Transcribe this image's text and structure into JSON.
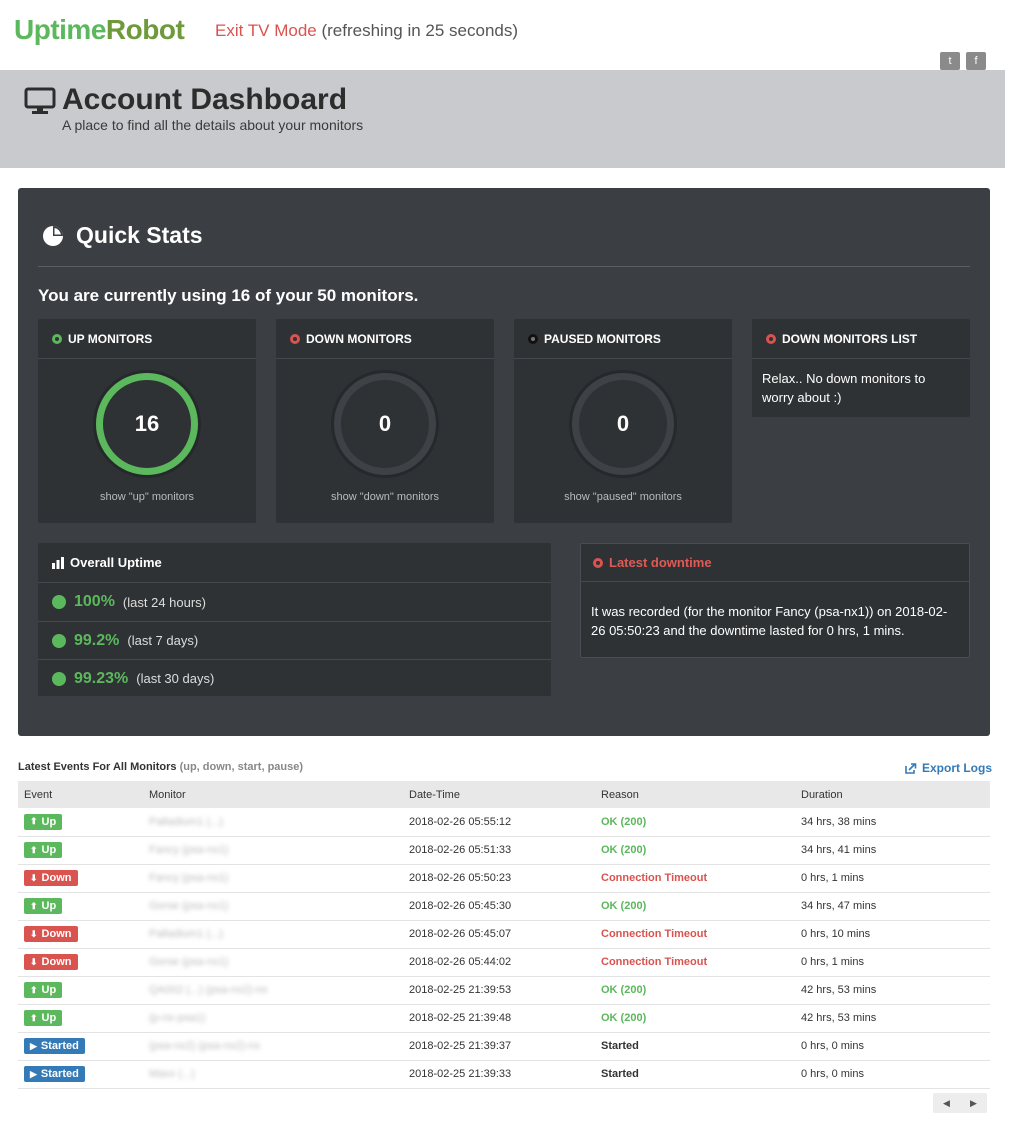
{
  "brand": {
    "uptime": "Uptime",
    "robot": "Robot"
  },
  "tv": {
    "exit_label": "Exit TV Mode",
    "refresh_text": "(refreshing in 25 seconds)"
  },
  "social": {
    "twitter": "t",
    "facebook": "f"
  },
  "header": {
    "title": "Account Dashboard",
    "subtitle": "A place to find all the details about your monitors"
  },
  "quick_stats": {
    "title": "Quick Stats",
    "usage": "You are currently using 16 of your 50 monitors.",
    "up": {
      "label": "UP MONITORS",
      "count": "16",
      "link": "show \"up\" monitors"
    },
    "down": {
      "label": "DOWN MONITORS",
      "count": "0",
      "link": "show \"down\" monitors"
    },
    "paused": {
      "label": "PAUSED MONITORS",
      "count": "0",
      "link": "show \"paused\" monitors"
    },
    "down_list": {
      "label": "DOWN MONITORS LIST",
      "text": "Relax.. No down monitors to worry about :)"
    },
    "overall": {
      "label": "Overall Uptime",
      "rows": [
        {
          "value": "100%",
          "period": "(last 24 hours)"
        },
        {
          "value": "99.2%",
          "period": "(last 7 days)"
        },
        {
          "value": "99.23%",
          "period": "(last 30 days)"
        }
      ]
    },
    "latest_downtime": {
      "label": "Latest downtime",
      "text": "It was recorded (for the monitor Fancy (psa-nx1)) on 2018-02-26 05:50:23 and the downtime lasted for 0 hrs, 1 mins."
    }
  },
  "events": {
    "title": "Latest Events For All Monitors",
    "filters": "(up, down, start, pause)",
    "export_label": "Export Logs",
    "columns": [
      "Event",
      "Monitor",
      "Date-Time",
      "Reason",
      "Duration"
    ],
    "rows": [
      {
        "type": "up",
        "event": "Up",
        "monitor": "Palladium1 (...)",
        "datetime": "2018-02-26 05:55:12",
        "reason": "OK (200)",
        "duration": "34 hrs, 38 mins"
      },
      {
        "type": "up",
        "event": "Up",
        "monitor": "Fancy (psa-nx1)",
        "datetime": "2018-02-26 05:51:33",
        "reason": "OK (200)",
        "duration": "34 hrs, 41 mins"
      },
      {
        "type": "down",
        "event": "Down",
        "monitor": "Fancy (psa-nx1)",
        "datetime": "2018-02-26 05:50:23",
        "reason": "Connection Timeout",
        "duration": "0 hrs, 1 mins"
      },
      {
        "type": "up",
        "event": "Up",
        "monitor": "Gorse (psa-nx1)",
        "datetime": "2018-02-26 05:45:30",
        "reason": "OK (200)",
        "duration": "34 hrs, 47 mins"
      },
      {
        "type": "down",
        "event": "Down",
        "monitor": "Palladium1 (...)",
        "datetime": "2018-02-26 05:45:07",
        "reason": "Connection Timeout",
        "duration": "0 hrs, 10 mins"
      },
      {
        "type": "down",
        "event": "Down",
        "monitor": "Gorse (psa-nx1)",
        "datetime": "2018-02-26 05:44:02",
        "reason": "Connection Timeout",
        "duration": "0 hrs, 1 mins"
      },
      {
        "type": "up",
        "event": "Up",
        "monitor": "QA002 (...) (psa-nx2)-nx",
        "datetime": "2018-02-25 21:39:53",
        "reason": "OK (200)",
        "duration": "42 hrs, 53 mins"
      },
      {
        "type": "up",
        "event": "Up",
        "monitor": "(p-nx-psa1)",
        "datetime": "2018-02-25 21:39:48",
        "reason": "OK (200)",
        "duration": "42 hrs, 53 mins"
      },
      {
        "type": "started",
        "event": "Started",
        "monitor": "(psa-nx2) (psa-nx2)-nx",
        "datetime": "2018-02-25 21:39:37",
        "reason": "Started",
        "duration": "0 hrs, 0 mins"
      },
      {
        "type": "started",
        "event": "Started",
        "monitor": "Maxx (...)",
        "datetime": "2018-02-25 21:39:33",
        "reason": "Started",
        "duration": "0 hrs, 0 mins"
      }
    ]
  },
  "pager": {
    "prev": "◀",
    "next": "▶"
  },
  "colors": {
    "up": "#5cb85c",
    "down": "#d9534f",
    "started": "#337ab7",
    "panel": "#3b3e42",
    "header_band": "#c9cacd"
  }
}
